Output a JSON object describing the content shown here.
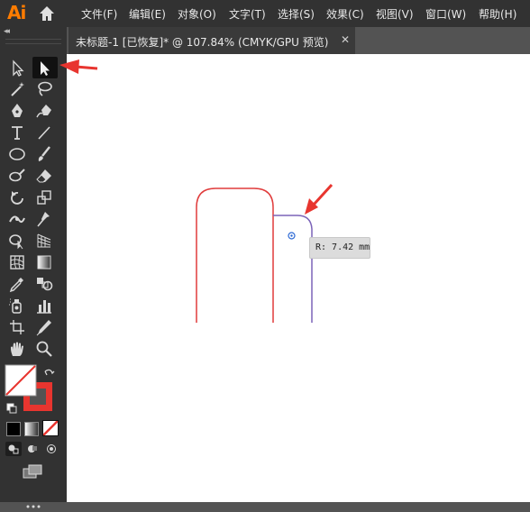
{
  "app": {
    "logo": "Ai",
    "menus": [
      "文件(F)",
      "编辑(E)",
      "对象(O)",
      "文字(T)",
      "选择(S)",
      "效果(C)",
      "视图(V)",
      "窗口(W)",
      "帮助(H)"
    ]
  },
  "tabs": [
    {
      "label": "未标题-1 [已恢复]* @ 107.84% (CMYK/GPU 预览)",
      "close": "✕"
    }
  ],
  "toolbar": {
    "collapse": "◂◂",
    "tools": [
      "selection-tool-icon",
      "direct-selection-tool-icon",
      "magic-wand-tool-icon",
      "lasso-tool-icon",
      "pen-tool-icon",
      "curvature-tool-icon",
      "type-tool-icon",
      "line-segment-tool-icon",
      "ellipse-tool-icon",
      "paintbrush-tool-icon",
      "shaper-tool-icon",
      "eraser-tool-icon",
      "rotate-tool-icon",
      "scale-tool-icon",
      "width-tool-icon",
      "puppet-warp-tool-icon",
      "shape-builder-tool-icon",
      "perspective-grid-tool-icon",
      "mesh-tool-icon",
      "gradient-tool-icon",
      "eyedropper-tool-icon",
      "blend-tool-icon",
      "symbol-sprayer-tool-icon",
      "column-graph-tool-icon",
      "artboard-tool-icon",
      "slice-tool-icon",
      "hand-tool-icon",
      "zoom-tool-icon"
    ],
    "fill_color": "none",
    "stroke_color": "#e8352f"
  },
  "tooltip": {
    "text": "R: 7.42 mm"
  },
  "colors": {
    "stroke_red": "#e03c3c",
    "stroke_blue": "#7b63b8",
    "arrow": "#e8352f",
    "point_blue": "#2f6bd6"
  }
}
